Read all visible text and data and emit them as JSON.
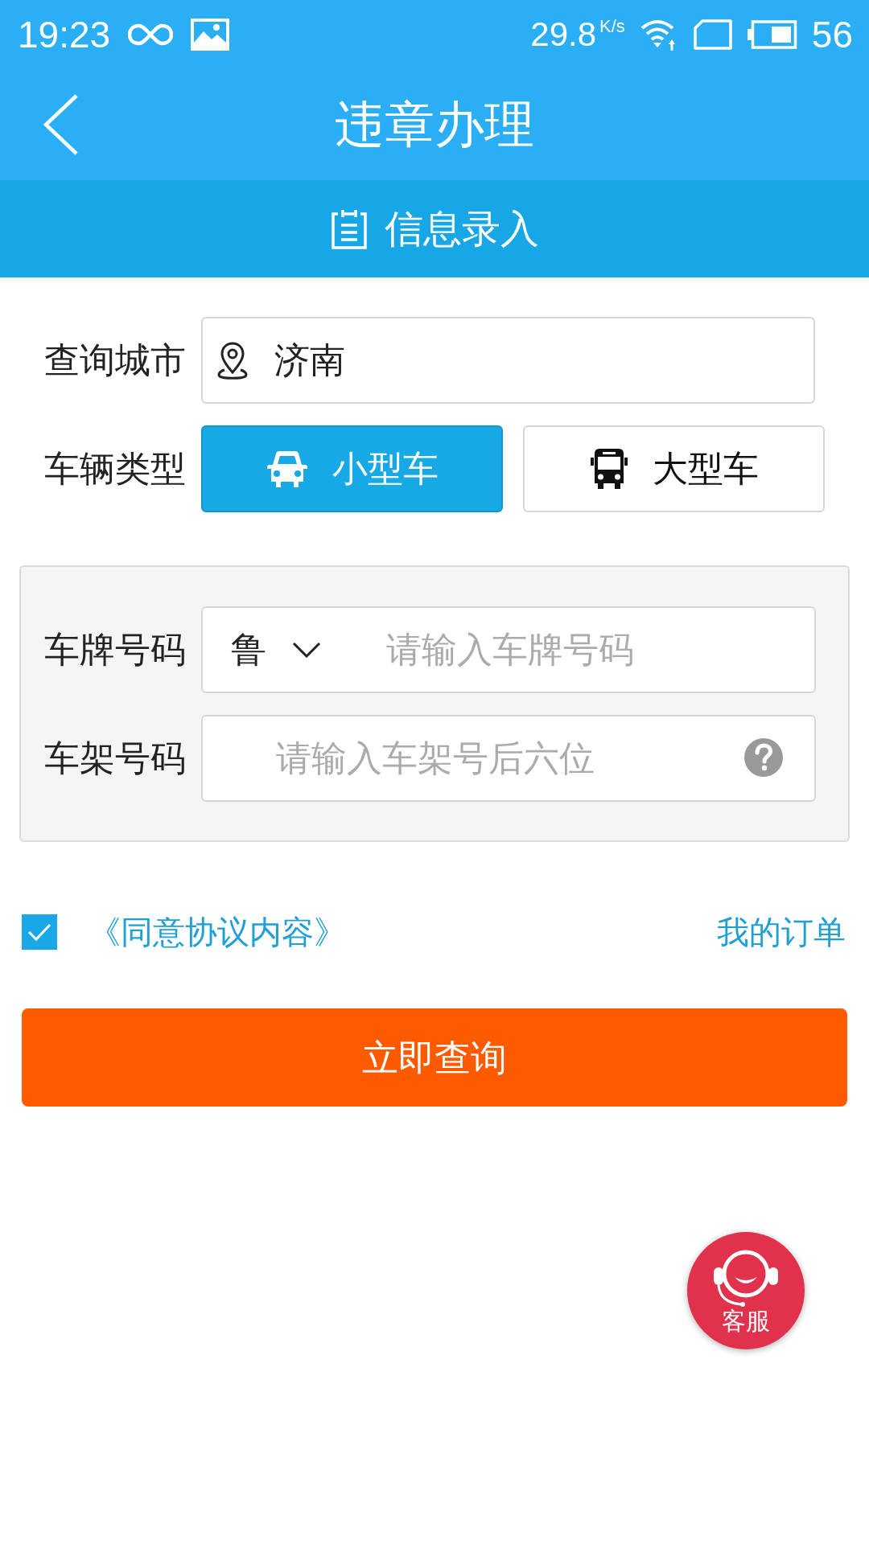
{
  "status_bar": {
    "time": "19:23",
    "network_speed": "29.8",
    "speed_unit": "K/s",
    "battery": "56"
  },
  "header": {
    "title": "违章办理"
  },
  "section_tab": {
    "label": "信息录入"
  },
  "form": {
    "city": {
      "label": "查询城市",
      "value": "济南"
    },
    "vehicle_type": {
      "label": "车辆类型",
      "options": [
        {
          "label": "小型车",
          "kind": "car",
          "selected": true
        },
        {
          "label": "大型车",
          "kind": "bus",
          "selected": false
        }
      ]
    },
    "plate": {
      "label": "车牌号码",
      "province": "鲁",
      "placeholder": "请输入车牌号码"
    },
    "frame": {
      "label": "车架号码",
      "placeholder": "请输入车架号后六位"
    }
  },
  "agreement": {
    "checked": true,
    "label": "《同意协议内容》"
  },
  "orders_link": "我的订单",
  "submit": "立即查询",
  "service_button": {
    "label": "客服"
  }
}
